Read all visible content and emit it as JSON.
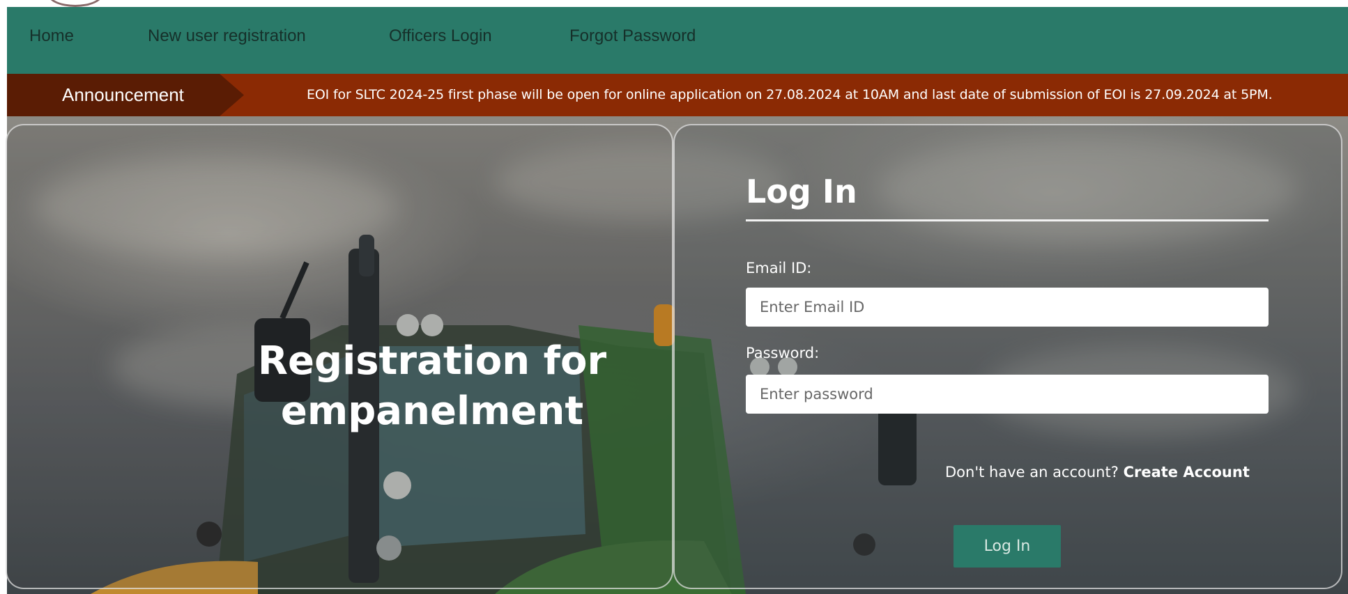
{
  "nav": {
    "items": [
      {
        "label": "Home"
      },
      {
        "label": "New user registration"
      },
      {
        "label": "Officers Login"
      },
      {
        "label": "Forgot Password"
      }
    ]
  },
  "announcement": {
    "tag": "Announcement",
    "text": "EOI for SLTC 2024-25 first phase will be open for online application on 27.08.2024 at 10AM and last date of submission of EOI is 27.09.2024 at 5PM."
  },
  "hero": {
    "title": "Registration for empanelment"
  },
  "login": {
    "title": "Log In",
    "email_label": "Email ID:",
    "email_placeholder": "Enter Email ID",
    "email_value": "",
    "password_label": "Password:",
    "password_placeholder": "Enter password",
    "password_value": "",
    "no_account_text": "Don't have an account?",
    "create_account_label": "Create Account",
    "submit_label": "Log In"
  },
  "colors": {
    "nav_bg": "#2a7a69",
    "announce_bg": "#8b2a04",
    "announce_tag_bg": "#5a1c04",
    "button_bg": "#2a7a69"
  }
}
